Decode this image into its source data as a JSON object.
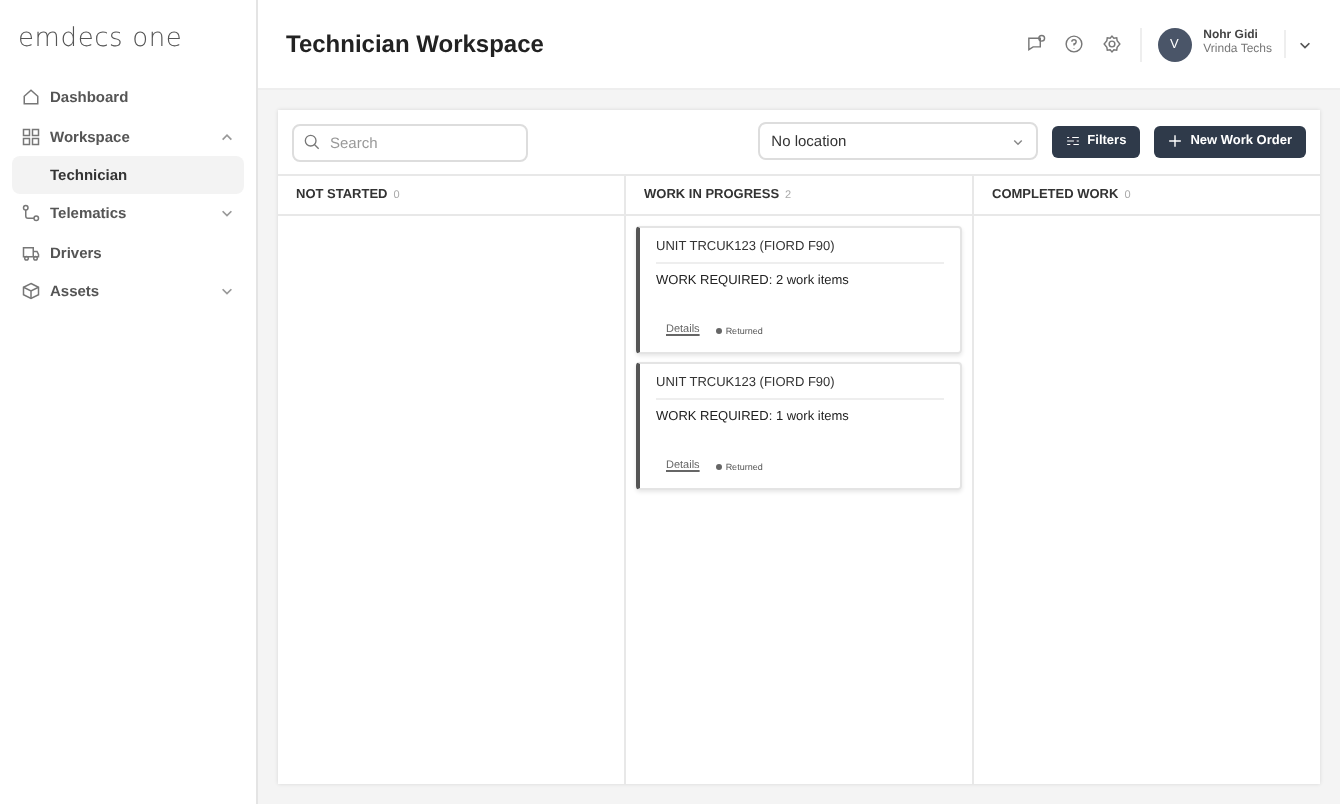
{
  "logo": "emdecs one",
  "nav": [
    {
      "label": "Dashboard",
      "kind": "home"
    },
    {
      "label": "Workspace",
      "kind": "grid",
      "expanded": true,
      "children": [
        {
          "label": "Technician",
          "selected": true
        }
      ]
    },
    {
      "label": "Telematics",
      "kind": "route",
      "expanded": false
    },
    {
      "label": "Drivers",
      "kind": "truck"
    },
    {
      "label": "Assets",
      "kind": "box",
      "expanded": false
    }
  ],
  "header": {
    "title": "Technician Workspace",
    "user": {
      "initial": "V",
      "name": "Nohr Gidi",
      "org": "Vrinda Techs"
    }
  },
  "toolbar": {
    "search_placeholder": "Search",
    "location": "No location",
    "filters": "Filters",
    "new_order": "New Work Order"
  },
  "columns": [
    {
      "title": "NOT STARTED",
      "count": "0"
    },
    {
      "title": "WORK IN PROGRESS",
      "count": "2",
      "cards": [
        {
          "title": "UNIT TRCUK123 (FIORD F90)",
          "work": "WORK REQUIRED: 2 work items",
          "link": "Details",
          "status": "Returned"
        },
        {
          "title": "UNIT TRCUK123 (FIORD F90)",
          "work": "WORK REQUIRED: 1 work items",
          "link": "Details",
          "status": "Returned"
        }
      ]
    },
    {
      "title": "COMPLETED WORK",
      "count": "0"
    }
  ]
}
